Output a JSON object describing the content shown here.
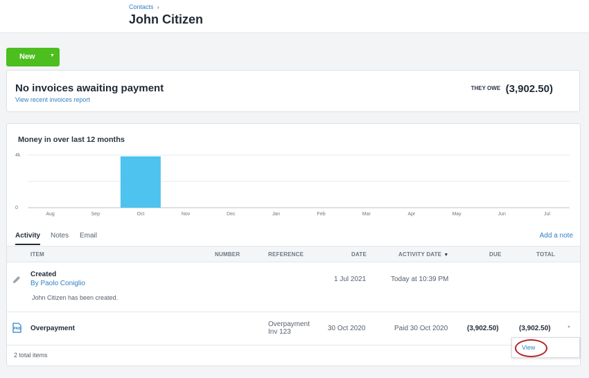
{
  "header": {
    "breadcrumb": "Contacts",
    "breadcrumb_sep": "›",
    "title": "John Citizen"
  },
  "new_button": {
    "label": "New",
    "caret": "▼"
  },
  "invoices_card": {
    "title": "No invoices awaiting payment",
    "link": "View recent invoices report",
    "owe_label": "THEY OWE",
    "owe_amount": "(3,902.50)"
  },
  "chart_data": {
    "type": "bar",
    "title": "Money in over last 12 months",
    "categories": [
      "Aug",
      "Sep",
      "Oct",
      "Nov",
      "Dec",
      "Jan",
      "Feb",
      "Mar",
      "Apr",
      "May",
      "Jun",
      "Jul"
    ],
    "values": [
      0,
      0,
      3902.5,
      0,
      0,
      0,
      0,
      0,
      0,
      0,
      0,
      0
    ],
    "ylim": [
      0,
      4000
    ],
    "y_ticks": [
      "0",
      "4k"
    ],
    "grid": true,
    "bar_color": "#4fc3f0"
  },
  "tabs": {
    "activity": "Activity",
    "notes": "Notes",
    "email": "Email",
    "add_note": "Add a note"
  },
  "table": {
    "headers": {
      "item": "ITEM",
      "number": "NUMBER",
      "reference": "REFERENCE",
      "date": "DATE",
      "activity_date": "ACTIVITY DATE",
      "due": "DUE",
      "total": "TOTAL"
    },
    "sort_icon": "▼",
    "rows": [
      {
        "icon": "pencil-icon",
        "title": "Created",
        "subtitle": "By Paolo Coniglio",
        "note": "John Citizen has been created.",
        "date": "1 Jul 2021",
        "activity_date": "Today at 10:39 PM"
      },
      {
        "icon": "paid-document-icon",
        "title": "Overpayment",
        "reference_line1": "Overpayment",
        "reference_line2": "Inv 123",
        "date": "30 Oct 2020",
        "activity_date": "Paid 30 Oct 2020",
        "due": "(3,902.50)",
        "total": "(3,902.50)",
        "menu_caret": "▼"
      }
    ],
    "footer": "2 total items"
  },
  "popup": {
    "view_label": "View"
  },
  "colors": {
    "accent": "#2f7fc2",
    "new_button": "#4cbe1e",
    "highlight_ring": "#b3262c"
  }
}
